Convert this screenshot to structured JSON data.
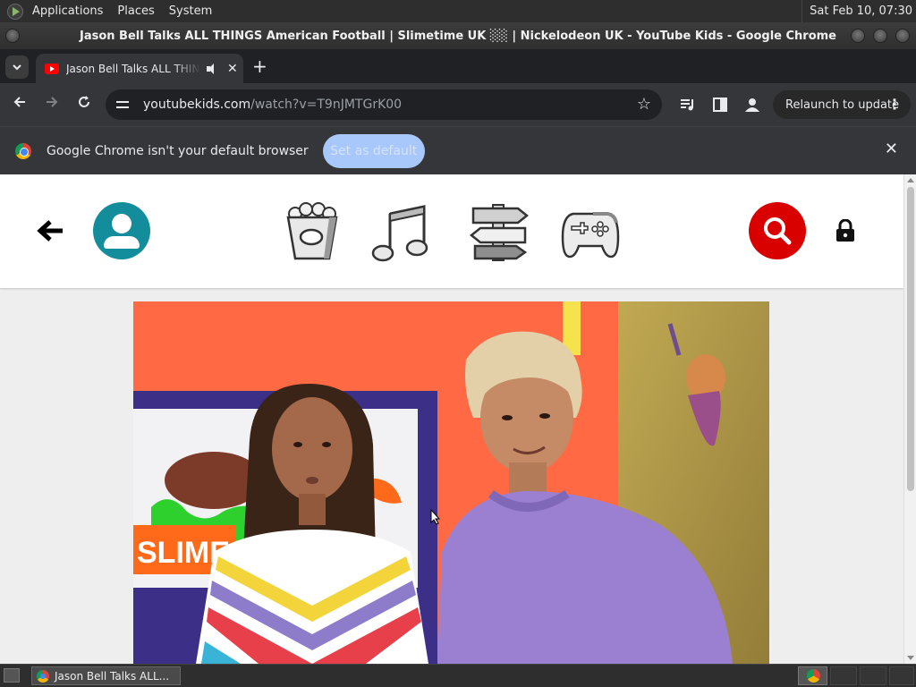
{
  "top_panel": {
    "menu": [
      "Applications",
      "Places",
      "System"
    ],
    "clock": "Sat Feb 10, 07:30"
  },
  "window": {
    "title": "Jason Bell Talks ALL THINGS American Football | Slimetime UK ░░ | Nickelodeon UK - YouTube Kids - Google Chrome"
  },
  "tabs": [
    {
      "title": "Jason Bell Talks ALL THINGS American Football | Slimetime UK",
      "active": true,
      "audio": true
    }
  ],
  "toolbar": {
    "url_host": "youtubekids.com",
    "url_path": "/watch?v=T9nJMTGrK00",
    "relaunch_label": "Relaunch to update"
  },
  "infobar": {
    "message": "Google Chrome isn't your default browser",
    "button_label": "Set as default"
  },
  "youtube_kids": {
    "categories": [
      "shows-icon",
      "music-icon",
      "explore-icon",
      "gaming-icon"
    ]
  },
  "taskbar": {
    "task_label": "Jason Bell Talks ALL..."
  },
  "colors": {
    "profile": "#138d9c",
    "search": "#d90000",
    "infobar_button": "#a8c7fa"
  }
}
